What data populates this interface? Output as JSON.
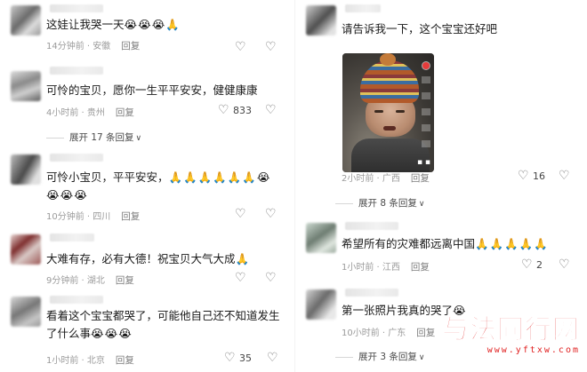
{
  "left_column": {
    "comments": [
      {
        "text": "这娃让我哭一天",
        "emojis": "😭😭😭🙏",
        "time": "14分钟前",
        "location": "安徽",
        "reply_label": "回复",
        "likes": ""
      },
      {
        "text": "可怜的宝贝，愿你一生平平安安，健健康康",
        "emojis": "",
        "time": "4小时前",
        "location": "贵州",
        "reply_label": "回复",
        "likes": "833"
      },
      {
        "text": "可怜小宝贝，平平安安，",
        "emojis": "🙏🙏🙏🙏🙏🙏😭",
        "emojis_line2": "😭😭😭",
        "time": "10分钟前",
        "location": "四川",
        "reply_label": "回复",
        "likes": ""
      },
      {
        "text": "大难有存，必有大德！祝宝贝大气大成",
        "emojis": "🙏",
        "time": "9分钟前",
        "location": "湖北",
        "reply_label": "回复",
        "likes": ""
      },
      {
        "text": "看着这个宝宝都哭了，可能他自己还不知道发生了什么事",
        "emojis": "😭😭😭",
        "time": "1小时前",
        "location": "北京",
        "reply_label": "回复",
        "likes": "35"
      }
    ],
    "expand_label": "展开 17 条回复"
  },
  "right_column": {
    "comments": [
      {
        "text": "请告诉我一下，这个宝宝还好吧",
        "emojis": "",
        "time": "2小时前",
        "location": "广西",
        "reply_label": "回复",
        "likes": "16"
      },
      {
        "text": "希望所有的灾难都远离中国",
        "emojis": "🙏🙏🙏🙏🙏",
        "time": "1小时前",
        "location": "江西",
        "reply_label": "回复",
        "likes": "2"
      },
      {
        "text": "第一张照片我真的哭了",
        "emojis": "😭",
        "time": "10小时前",
        "location": "广东",
        "reply_label": "回复",
        "likes": ""
      }
    ],
    "expand_label_1": "展开 8 条回复",
    "expand_label_2": "展开 3 条回复"
  },
  "watermark": {
    "main": "与法同行网",
    "sub": "www.yftxw.com"
  },
  "icons": {
    "heart": "heart-icon",
    "dislike": "broken-heart-icon",
    "chevron": "chevron-down-icon"
  },
  "colors": {
    "watermark_red": "#e02020",
    "meta_gray": "#9b9b9b"
  }
}
